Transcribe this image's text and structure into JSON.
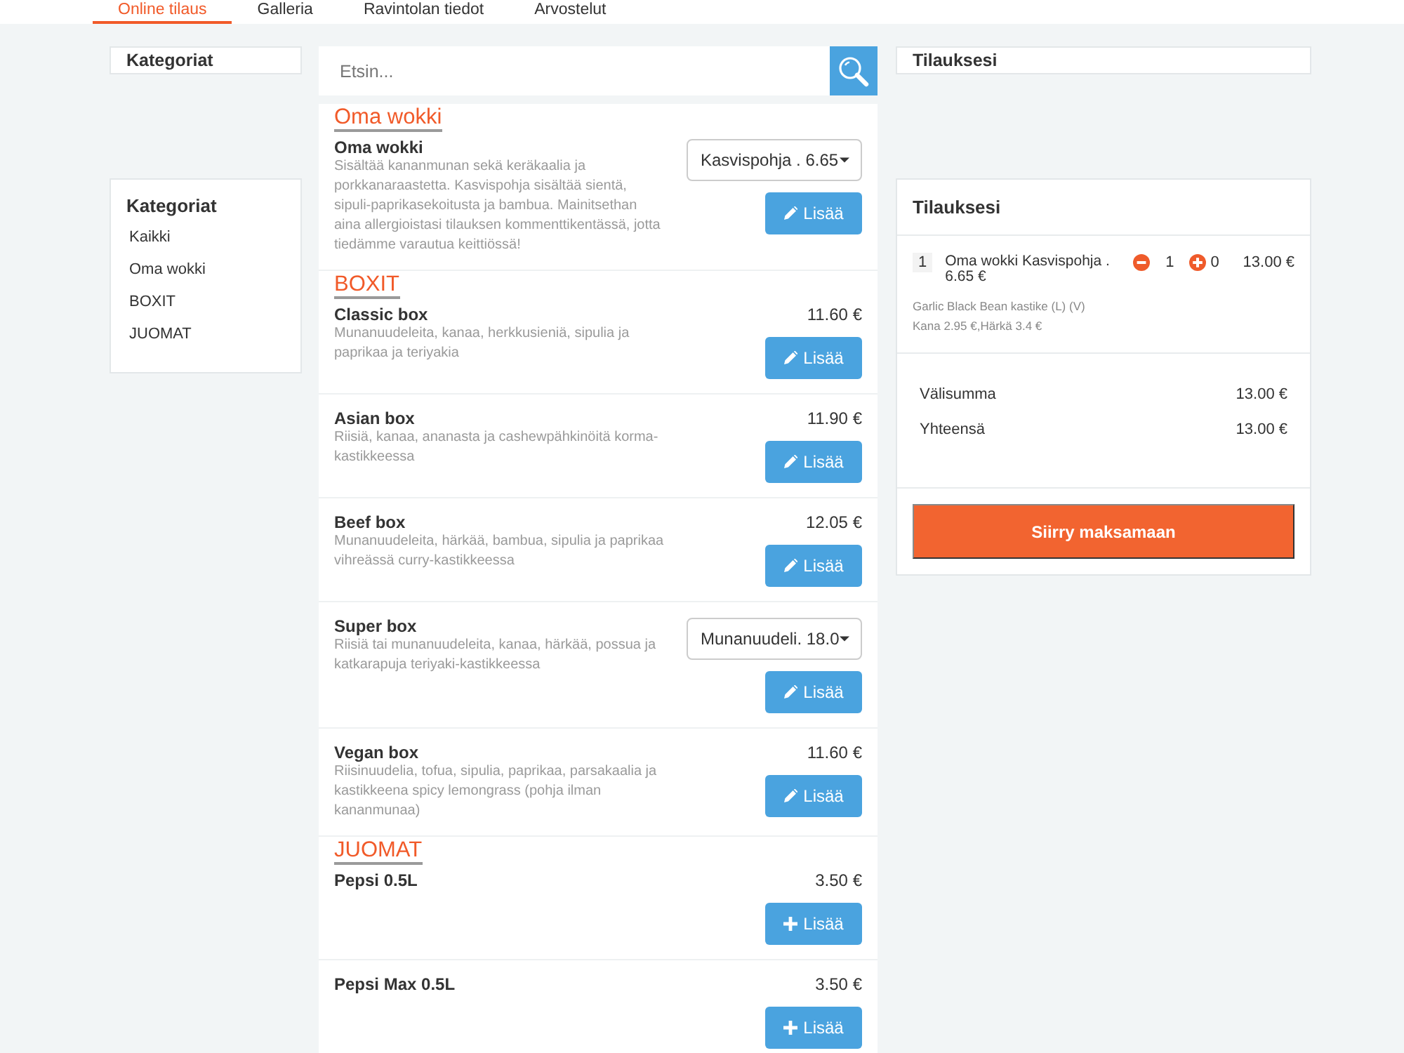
{
  "nav": {
    "tabs": [
      {
        "label": "Online tilaus",
        "selected": true
      },
      {
        "label": "Galleria",
        "selected": false
      },
      {
        "label": "Ravintolan tiedot",
        "selected": false
      },
      {
        "label": "Arvostelut",
        "selected": false
      }
    ]
  },
  "categories": {
    "pinned_title": "Kategoriat",
    "title": "Kategoriat",
    "items": [
      "Kaikki",
      "Oma wokki",
      "BOXIT",
      "JUOMAT"
    ]
  },
  "search": {
    "placeholder": "Etsin..."
  },
  "menu": {
    "sections": [
      {
        "title": "Oma wokki",
        "items": [
          {
            "kind": "options",
            "name": "Oma wokki",
            "description": "Sisältää kananmunan sekä keräkaalia ja porkkanaraastetta. Kasvispohja sisältää sientä, sipuli-paprikasekoitusta ja bambua. Mainitsethan aina allergioistasi tilauksen kommenttikentässä, jotta tiedämme varautua keittiössä!",
            "option": "Kasvispohja . 6.65",
            "button": "Lisää"
          }
        ]
      },
      {
        "title": "BOXIT",
        "items": [
          {
            "kind": "custom",
            "name": "Classic box",
            "description": "Munanuudeleita, kanaa, herkkusieniä, sipulia ja paprikaa ja teriyakia",
            "price": "11.60 €",
            "button": "Lisää"
          },
          {
            "kind": "custom",
            "name": "Asian box",
            "description": "Riisiä, kanaa, ananasta ja cashewpähkinöitä korma-kastikkeessa",
            "price": "11.90 €",
            "button": "Lisää"
          },
          {
            "kind": "custom",
            "name": "Beef box",
            "description": "Munanuudeleita, härkää, bambua, sipulia ja paprikaa vihreässä curry-kastikkeessa",
            "price": "12.05 €",
            "button": "Lisää"
          },
          {
            "kind": "options",
            "name": "Super box",
            "description": "Riisiä tai munanuudeleita, kanaa, härkää, possua ja katkarapuja teriyaki-kastikkeessa",
            "option": "Munanuudeli. 18.0",
            "button": "Lisää"
          },
          {
            "kind": "custom",
            "name": "Vegan box",
            "description": "Riisinuudelia, tofua, sipulia, paprikaa, parsakaalia ja kastikkeena spicy lemongrass (pohja ilman kananmunaa)",
            "price": "11.60 €",
            "button": "Lisää"
          }
        ]
      },
      {
        "title": "JUOMAT",
        "items": [
          {
            "kind": "plain",
            "name": "Pepsi 0.5L",
            "price": "3.50 €",
            "button": "Lisää"
          },
          {
            "kind": "plain",
            "name": "Pepsi Max 0.5L",
            "price": "3.50 €",
            "button": "Lisää"
          }
        ]
      }
    ]
  },
  "order": {
    "pinned_title": "Tilauksesi",
    "title": "Tilauksesi",
    "items": [
      {
        "quantity": "1",
        "name": "Oma wokki Kasvispohja . 6.65 €",
        "count": "1",
        "extra_count": "0",
        "total": "13.00 €",
        "notes": [
          "Garlic Black Bean kastike (L) (V)",
          "Kana 2.95 €,Härkä 3.4 €"
        ]
      }
    ],
    "totals": [
      {
        "label": "Välisumma",
        "value": "13.00 €"
      },
      {
        "label": "Yhteensä",
        "value": "13.00 €"
      }
    ],
    "checkout_button": "Siirry maksamaan"
  }
}
